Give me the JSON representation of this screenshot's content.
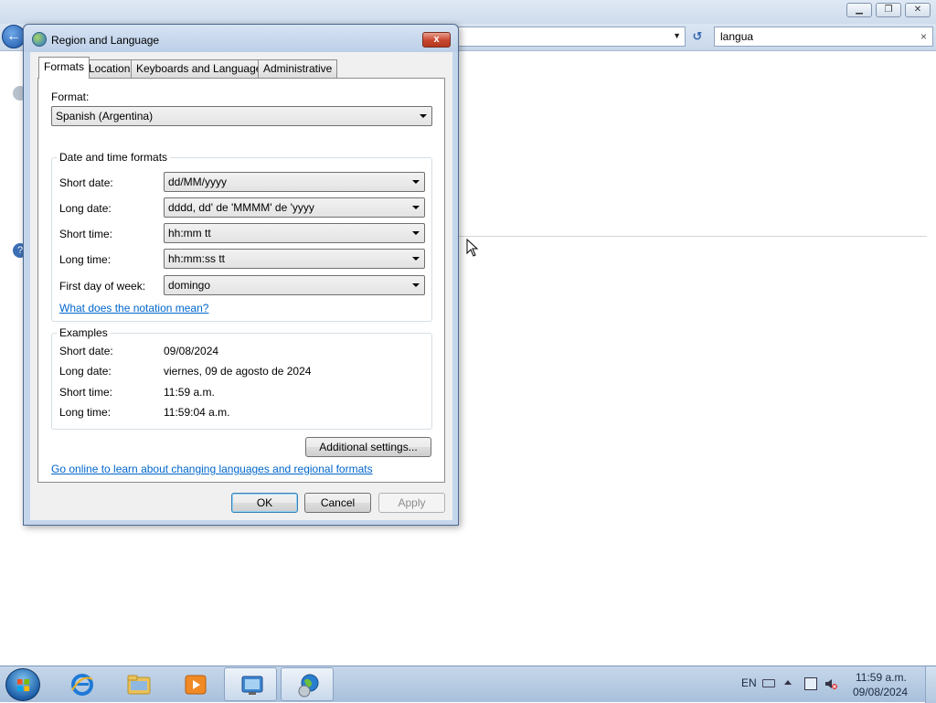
{
  "background_window": {
    "search_value": "langua",
    "search_clear": "×",
    "address_dropdown": "▼",
    "refresh": "↺",
    "back": "←"
  },
  "dialog": {
    "title": "Region and Language",
    "close": "x",
    "tabs": [
      {
        "label": "Formats",
        "active": true
      },
      {
        "label": "Location",
        "active": false
      },
      {
        "label": "Keyboards and Languages",
        "active": false
      },
      {
        "label": "Administrative",
        "active": false
      }
    ],
    "format_label": "Format:",
    "format_value": "Spanish (Argentina)",
    "date_time_group": {
      "title": "Date and time formats",
      "rows": [
        {
          "label": "Short date:",
          "value": "dd/MM/yyyy"
        },
        {
          "label": "Long date:",
          "value": "dddd, dd' de 'MMMM' de 'yyyy"
        },
        {
          "label": "Short time:",
          "value": "hh:mm tt"
        },
        {
          "label": "Long time:",
          "value": "hh:mm:ss tt"
        },
        {
          "label": "First day of week:",
          "value": "domingo"
        }
      ],
      "notation_link": "What does the notation mean?"
    },
    "examples_group": {
      "title": "Examples",
      "rows": [
        {
          "label": "Short date:",
          "value": "09/08/2024"
        },
        {
          "label": "Long date:",
          "value": "viernes, 09 de agosto de 2024"
        },
        {
          "label": "Short time:",
          "value": "11:59 a.m."
        },
        {
          "label": "Long time:",
          "value": "11:59:04 a.m."
        }
      ]
    },
    "additional_settings": "Additional settings...",
    "online_link": "Go online to learn about changing languages and regional formats",
    "buttons": {
      "ok": "OK",
      "cancel": "Cancel",
      "apply": "Apply"
    }
  },
  "taskbar": {
    "items": [
      {
        "name": "internet-explorer",
        "active": false
      },
      {
        "name": "windows-explorer",
        "active": false
      },
      {
        "name": "media-player",
        "active": false
      },
      {
        "name": "control-panel",
        "active": true
      },
      {
        "name": "region-language",
        "active": true
      }
    ],
    "tray": {
      "language": "EN",
      "time": "11:59 a.m.",
      "date": "09/08/2024"
    }
  }
}
